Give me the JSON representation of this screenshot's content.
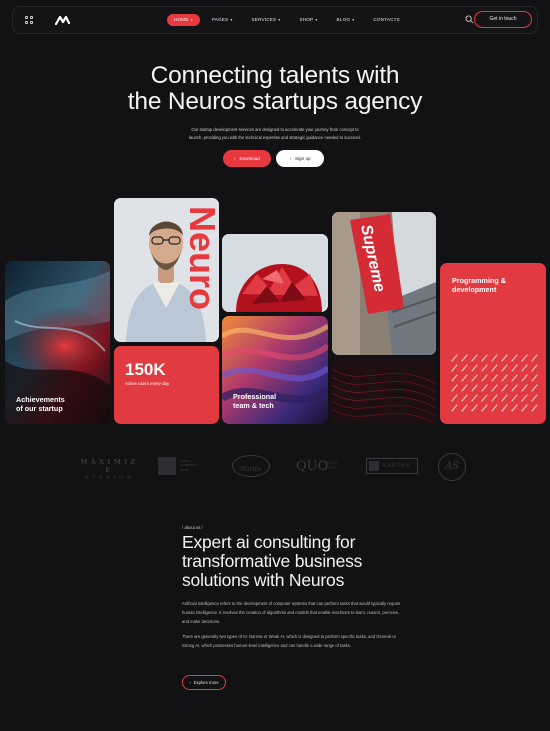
{
  "header": {
    "nav": [
      {
        "label": "HOME",
        "caret": true,
        "active": true
      },
      {
        "label": "PAGES",
        "caret": true
      },
      {
        "label": "SERVICES",
        "caret": true
      },
      {
        "label": "SHOP",
        "caret": true
      },
      {
        "label": "BLOG",
        "caret": true
      },
      {
        "label": "CONTACTS",
        "caret": false
      }
    ],
    "cta_label": "Get in touch"
  },
  "hero": {
    "title_line1": "Connecting talents with",
    "title_line2": "the Neuros startups agency",
    "subtitle_line1": "Our startup development services are designed to accelerate your journey from concept to",
    "subtitle_line2": "launch, providing you with the technical expertise and strategic guidance needed to succeed.",
    "download_label": "Download",
    "signup_label": "Sign up"
  },
  "gallery": {
    "achievements_line1": "Achievements",
    "achievements_line2": "of our startup",
    "neuro_word": "Neuro",
    "stat_value": "150K",
    "stat_caption": "Active users every day",
    "professional_line1": "Professional",
    "professional_line2": "team & tech",
    "supreme_word": "Supreme",
    "programming_line1": "Programming &",
    "programming_line2": "development"
  },
  "brands": {
    "b1_line1": "M A X I M I Z E",
    "b1_line2": "N T E R I O R",
    "b2_line1": "Modern",
    "b2_line2": "Architecture",
    "b2_line3": "Studio",
    "b3": "Marble",
    "b4_main": "QUO",
    "b4_side1": "LEGAL",
    "b4_side2": "FIRM",
    "b5": "E A R T H S",
    "b6": "AS"
  },
  "about": {
    "tag": "/ about us /",
    "title_line1": "Expert ai consulting for",
    "title_line2": "transformative business",
    "title_line3": "solutions with Neuros",
    "p1": "Artificial intelligence refers to the development of computer systems that can perform tasks that would typically require human intelligence. It involves the creation of algorithms and models that enable machines to learn, reason, perceive, and make decisions.",
    "p2": "There are generally two types of AI: Narrow or Weak AI, which is designed to perform specific tasks, and General or Strong AI, which possesses human-level intelligence and can handle a wide range of tasks.",
    "explore_label": "Explore more"
  },
  "colors": {
    "accent": "#e8393e",
    "background": "#121214"
  }
}
